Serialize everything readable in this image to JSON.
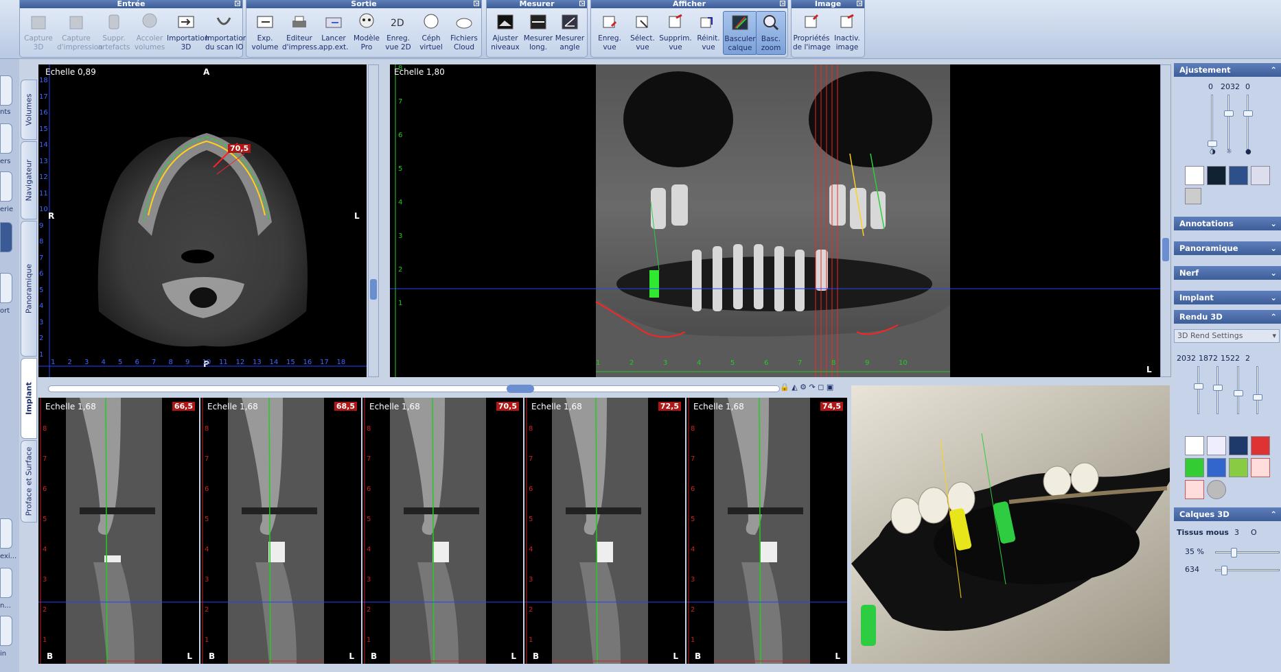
{
  "ribbon": {
    "groups": [
      {
        "title": "Entrée",
        "buttons": [
          {
            "label": "Capture\n3D",
            "icon": "capture-3d-icon",
            "enabled": false
          },
          {
            "label": "Capture\nd'impression",
            "icon": "capture-impression-icon",
            "enabled": false
          },
          {
            "label": "Suppr.\nartefacts",
            "icon": "remove-artifacts-icon",
            "enabled": false
          },
          {
            "label": "Accoler\nvolumes",
            "icon": "skull-icon",
            "enabled": false
          },
          {
            "label": "Importation\n3D",
            "icon": "import-3d-icon",
            "enabled": true
          },
          {
            "label": "Importation\ndu scan IO",
            "icon": "import-scan-io-icon",
            "enabled": true
          }
        ]
      },
      {
        "title": "Sortie",
        "buttons": [
          {
            "label": "Exp.\nvolume",
            "icon": "export-volume-icon",
            "enabled": true
          },
          {
            "label": "Editeur\nd'impress.",
            "icon": "print-editor-icon",
            "enabled": true
          },
          {
            "label": "Lancer\napp.ext.",
            "icon": "launch-external-app-icon",
            "enabled": true
          },
          {
            "label": "Modèle\nPro",
            "icon": "model-pro-skull-icon",
            "enabled": true
          },
          {
            "label": "Enreg.\nvue 2D",
            "icon": "save-2d-view-icon",
            "enabled": true
          },
          {
            "label": "Céph\nvirtuel",
            "icon": "virtual-ceph-icon",
            "enabled": true
          },
          {
            "label": "Fichiers\nCloud",
            "icon": "cloud-files-icon",
            "enabled": true
          }
        ]
      },
      {
        "title": "Mesurer",
        "buttons": [
          {
            "label": "Ajuster\nniveaux",
            "icon": "adjust-levels-icon",
            "enabled": true
          },
          {
            "label": "Mesurer\nlong.",
            "icon": "measure-length-icon",
            "enabled": true
          },
          {
            "label": "Mesurer\nangle",
            "icon": "measure-angle-icon",
            "enabled": true
          }
        ]
      },
      {
        "title": "Afficher",
        "buttons": [
          {
            "label": "Enreg.\nvue",
            "icon": "save-view-icon",
            "enabled": true
          },
          {
            "label": "Sélect.\nvue",
            "icon": "select-view-icon",
            "enabled": true
          },
          {
            "label": "Supprim.\nvue",
            "icon": "delete-view-icon",
            "enabled": true
          },
          {
            "label": "Réinit.\nvue",
            "icon": "reset-view-icon",
            "enabled": true
          },
          {
            "label": "Basculer\ncalque",
            "icon": "toggle-layer-icon",
            "enabled": true,
            "active": true
          },
          {
            "label": "Basc.\nzoom",
            "icon": "toggle-zoom-icon",
            "enabled": true,
            "active": true
          }
        ]
      },
      {
        "title": "Image",
        "buttons": [
          {
            "label": "Propriétés\nde l'image",
            "icon": "image-properties-icon",
            "enabled": true
          },
          {
            "label": "Inactiv.\nimage",
            "icon": "inactivate-image-icon",
            "enabled": true
          }
        ]
      }
    ]
  },
  "left_sidebar": {
    "labels": [
      "nts",
      "ers",
      "erie",
      "ort",
      "exi...",
      "n...",
      "in"
    ]
  },
  "vertical_tabs": [
    "Volumes",
    "Navigateur",
    "Panoramique",
    "Implant",
    "Proface et Surface"
  ],
  "selected_tab": "Implant",
  "axial_view": {
    "scale": "Echelle 0,89",
    "top_label": "A",
    "bottom_label": "P",
    "left_label": "R",
    "right_label": "L",
    "angle_label": "70,5",
    "ruler_left": [
      "18",
      "17",
      "16",
      "15",
      "14",
      "13",
      "12",
      "11",
      "10",
      "9",
      "8",
      "7",
      "6",
      "5",
      "4",
      "3",
      "2",
      "1"
    ],
    "ruler_bottom": [
      "1",
      "2",
      "3",
      "4",
      "5",
      "6",
      "7",
      "8",
      "9",
      "10",
      "11",
      "12",
      "13",
      "14",
      "15",
      "16",
      "17",
      "18"
    ]
  },
  "pano_view": {
    "scale": "Echelle 1,80",
    "right_label": "L",
    "ruler_left": [
      "8",
      "7",
      "6",
      "5",
      "4",
      "3",
      "2",
      "1"
    ],
    "ruler_bottom": [
      "1",
      "2",
      "3",
      "4",
      "5",
      "6",
      "7",
      "8",
      "9",
      "10"
    ]
  },
  "cross_sections": [
    {
      "scale": "Echelle 1,68",
      "position": "66,5",
      "bottom_left": "B",
      "bottom_right": "L"
    },
    {
      "scale": "Echelle 1,68",
      "position": "68,5",
      "bottom_left": "B",
      "bottom_right": "L"
    },
    {
      "scale": "Echelle 1,68",
      "position": "70,5",
      "bottom_left": "B",
      "bottom_right": "L"
    },
    {
      "scale": "Echelle 1,68",
      "position": "72,5",
      "bottom_left": "B",
      "bottom_right": "L"
    },
    {
      "scale": "Echelle 1,68",
      "position": "74,5",
      "bottom_left": "B",
      "bottom_right": "L"
    }
  ],
  "cross_ruler": [
    "8",
    "7",
    "6",
    "5",
    "4",
    "3",
    "2",
    "1"
  ],
  "right_panel": {
    "ajustement": {
      "title": "Ajustement",
      "values": [
        "0",
        "2032",
        "0"
      ]
    },
    "annotations": "Annotations",
    "panoramique": "Panoramique",
    "nerf": "Nerf",
    "implant": "Implant",
    "rendu3d": {
      "title": "Rendu 3D",
      "preset": "3D Rend Settings",
      "values": [
        "2032",
        "1872",
        "1522",
        "2"
      ]
    },
    "calques3d": {
      "title": "Calques 3D",
      "tissus_label": "Tissus mous",
      "opt1": "3",
      "opt2": "O",
      "opacity": "35 %",
      "level": "634"
    }
  },
  "colors": {
    "accent": "#3d5d99",
    "viewport_bg": "#000000",
    "ruler_green": "#22cc22",
    "ruler_red": "#cc2222",
    "ruler_blue": "#2244ff"
  }
}
